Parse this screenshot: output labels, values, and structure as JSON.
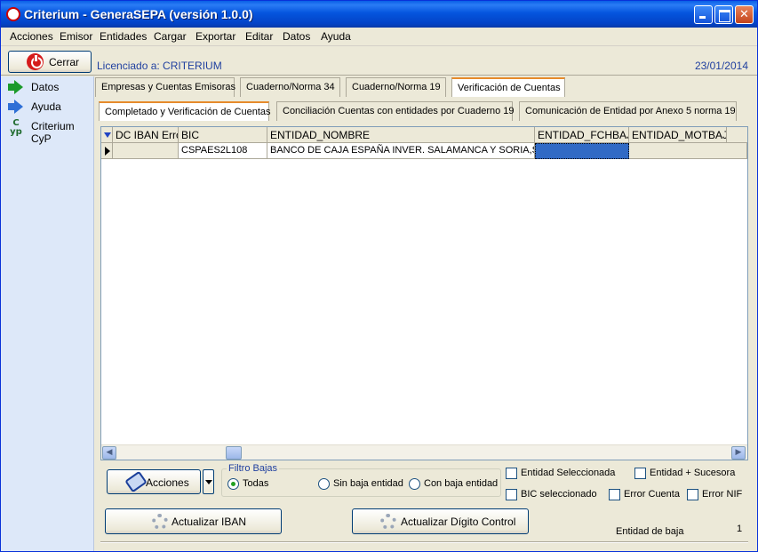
{
  "window": {
    "title": "Criterium - GeneraSEPA (versión 1.0.0)"
  },
  "menu": [
    "Acciones",
    "Emisor",
    "Entidades",
    "Cargar",
    "Exportar",
    "Editar",
    "Datos",
    "Ayuda"
  ],
  "topbar": {
    "close_label": "Cerrar",
    "licensed": "Licenciado a: CRITERIUM",
    "date": "23/01/2014"
  },
  "sidebar": {
    "items": [
      "Datos",
      "Ayuda",
      "Criterium CyP"
    ]
  },
  "tabs_main": [
    "Empresas y Cuentas Emisoras",
    "Cuaderno/Norma 34",
    "Cuaderno/Norma 19",
    "Verificación de Cuentas"
  ],
  "tabs_sub": [
    "Completado y Verificación de Cuentas",
    "Conciliación Cuentas con entidades por Cuaderno 19",
    "Comunicación de Entidad por Anexo 5 norma 19"
  ],
  "grid": {
    "columns": [
      "DC IBAN Error",
      "BIC",
      "ENTIDAD_NOMBRE",
      "ENTIDAD_FCHBAJA",
      "ENTIDAD_MOTBAJA"
    ],
    "rows": [
      {
        "dc_iban_error": "",
        "bic": "CSPAES2L108",
        "entidad_nombre": "BANCO DE CAJA ESPAÑA INVER. SALAMANCA Y SORIA,S.A.",
        "fchbaja": "",
        "motbaja": ""
      }
    ]
  },
  "bottom": {
    "acciones_label": "Acciones",
    "filtro_title": "Filtro Bajas",
    "filtro_options": [
      "Todas",
      "Sin baja entidad",
      "Con baja entidad"
    ],
    "filtro_selected": "Todas",
    "checks": [
      "Entidad Seleccionada",
      "Entidad + Sucesora",
      "BIC seleccionado",
      "Error Cuenta",
      "Error NIF"
    ],
    "actualizar_iban": "Actualizar IBAN",
    "actualizar_dc": "Actualizar Dígito Control",
    "status_label": "Entidad de baja",
    "status_count": "1"
  },
  "colors": {
    "accent": "#316ac5",
    "title_bar": "#0555de",
    "tab_highlight": "#e68b2c",
    "info_text": "#1f3f9f"
  }
}
